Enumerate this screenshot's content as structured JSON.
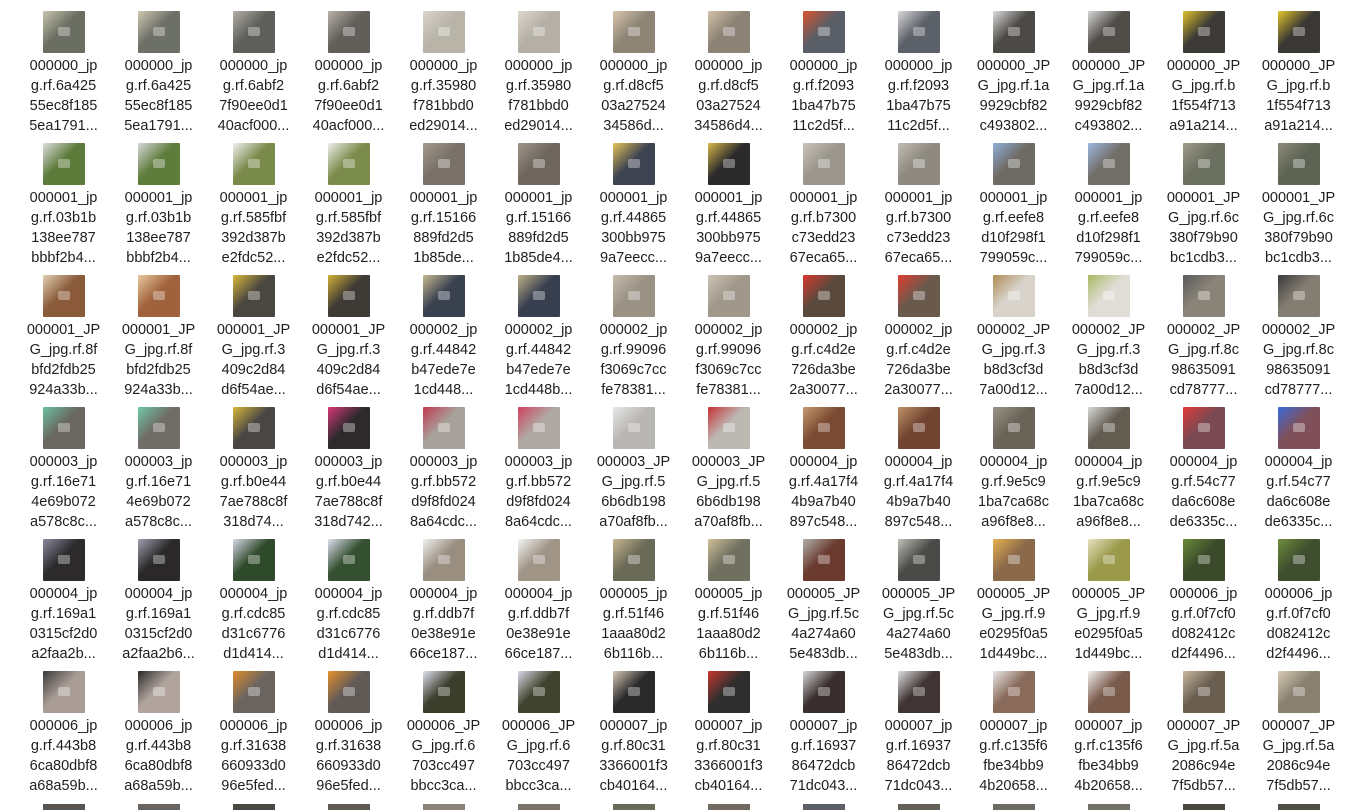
{
  "rows": [
    [
      {
        "lines": [
          "000000_jp",
          "g.rf.6a425",
          "55ec8f185",
          "5ea1791..."
        ],
        "thumb_color": "#6b6e62",
        "accent": "#c8c4b0"
      },
      {
        "lines": [
          "000000_jp",
          "g.rf.6a425",
          "55ec8f185",
          "5ea1791..."
        ],
        "thumb_color": "#6d7066",
        "accent": "#cfc8b3"
      },
      {
        "lines": [
          "000000_jp",
          "g.rf.6abf2",
          "7f90ee0d1",
          "40acf000..."
        ],
        "thumb_color": "#5e5e5a",
        "accent": "#b3b0a8"
      },
      {
        "lines": [
          "000000_jp",
          "g.rf.6abf2",
          "7f90ee0d1",
          "40acf000..."
        ],
        "thumb_color": "#625f5a",
        "accent": "#b8b3a9"
      },
      {
        "lines": [
          "000000_jp",
          "g.rf.35980",
          "f781bbd0",
          "ed29014..."
        ],
        "thumb_color": "#b9b4a8",
        "accent": "#dad5ca"
      },
      {
        "lines": [
          "000000_jp",
          "g.rf.35980",
          "f781bbd0",
          "ed29014..."
        ],
        "thumb_color": "#b5b0a5",
        "accent": "#ddd7cc"
      },
      {
        "lines": [
          "000000_jp",
          "g.rf.d8cf5",
          "03a27524",
          "34586d..."
        ],
        "thumb_color": "#8f8577",
        "accent": "#d8c6ac"
      },
      {
        "lines": [
          "000000_jp",
          "g.rf.d8cf5",
          "03a27524",
          "34586d4..."
        ],
        "thumb_color": "#8c8275",
        "accent": "#d2c1a6"
      },
      {
        "lines": [
          "000000_jp",
          "g.rf.f2093",
          "1ba47b75",
          "11c2d5f..."
        ],
        "thumb_color": "#5a5e66",
        "accent": "#d8542e"
      },
      {
        "lines": [
          "000000_jp",
          "g.rf.f2093",
          "1ba47b75",
          "11c2d5f..."
        ],
        "thumb_color": "#5c6068",
        "accent": "#d8d8d8"
      },
      {
        "lines": [
          "000000_JP",
          "G_jpg.rf.1a",
          "9929cbf82",
          "c493802..."
        ],
        "thumb_color": "#4c4a46",
        "accent": "#dcdcdc"
      },
      {
        "lines": [
          "000000_JP",
          "G_jpg.rf.1a",
          "9929cbf82",
          "c493802..."
        ],
        "thumb_color": "#504d48",
        "accent": "#d6d6d6"
      },
      {
        "lines": [
          "000000_JP",
          "G_jpg.rf.b",
          "1f554f713",
          "a91a214..."
        ],
        "thumb_color": "#3c3a36",
        "accent": "#e0c22a"
      },
      {
        "lines": [
          "000000_JP",
          "G_jpg.rf.b",
          "1f554f713",
          "a91a214..."
        ],
        "thumb_color": "#3a3834",
        "accent": "#e3c52c"
      }
    ],
    [
      {
        "lines": [
          "000001_jp",
          "g.rf.03b1b",
          "138ee787",
          "bbbf2b4..."
        ],
        "thumb_color": "#5c7a3a",
        "accent": "#dedede"
      },
      {
        "lines": [
          "000001_jp",
          "g.rf.03b1b",
          "138ee787",
          "bbbf2b4..."
        ],
        "thumb_color": "#5e7c3c",
        "accent": "#d8d8d8"
      },
      {
        "lines": [
          "000001_jp",
          "g.rf.585fbf",
          "392d387b",
          "e2fdc52..."
        ],
        "thumb_color": "#7a8a4a",
        "accent": "#f0f0f0"
      },
      {
        "lines": [
          "000001_jp",
          "g.rf.585fbf",
          "392d387b",
          "e2fdc52..."
        ],
        "thumb_color": "#7c8c4c",
        "accent": "#eeeeee"
      },
      {
        "lines": [
          "000001_jp",
          "g.rf.15166",
          "889fd2d5",
          "1b85de..."
        ],
        "thumb_color": "#7a7268",
        "accent": "#a39a8e"
      },
      {
        "lines": [
          "000001_jp",
          "g.rf.15166",
          "889fd2d5",
          "1b85de4..."
        ],
        "thumb_color": "#6f675d",
        "accent": "#9e958a"
      },
      {
        "lines": [
          "000001_jp",
          "g.rf.44865",
          "300bb975",
          "9a7eecc..."
        ],
        "thumb_color": "#3e4452",
        "accent": "#e5c35a"
      },
      {
        "lines": [
          "000001_jp",
          "g.rf.44865",
          "300bb975",
          "9a7eecc..."
        ],
        "thumb_color": "#2a2a2a",
        "accent": "#d9b84a"
      },
      {
        "lines": [
          "000001_jp",
          "g.rf.b7300",
          "c73edd23",
          "67eca65..."
        ],
        "thumb_color": "#9a968c",
        "accent": "#c8c4ba"
      },
      {
        "lines": [
          "000001_jp",
          "g.rf.b7300",
          "c73edd23",
          "67eca65..."
        ],
        "thumb_color": "#8e8a80",
        "accent": "#c0bcb2"
      },
      {
        "lines": [
          "000001_jp",
          "g.rf.eefe8",
          "d10f298f1",
          "799059c..."
        ],
        "thumb_color": "#6e6a64",
        "accent": "#8fb0d8"
      },
      {
        "lines": [
          "000001_jp",
          "g.rf.eefe8",
          "d10f298f1",
          "799059c..."
        ],
        "thumb_color": "#726e68",
        "accent": "#9ab8de"
      },
      {
        "lines": [
          "000001_JP",
          "G_jpg.rf.6c",
          "380f79b90",
          "bc1cdb3..."
        ],
        "thumb_color": "#6c7060",
        "accent": "#a09a8a"
      },
      {
        "lines": [
          "000001_JP",
          "G_jpg.rf.6c",
          "380f79b90",
          "bc1cdb3..."
        ],
        "thumb_color": "#5e6454",
        "accent": "#8e8a7a"
      }
    ],
    [
      {
        "lines": [
          "000001_JP",
          "G_jpg.rf.8f",
          "bfd2fdb25",
          "924a33b..."
        ],
        "thumb_color": "#8a5a3a",
        "accent": "#e0d0b0"
      },
      {
        "lines": [
          "000001_JP",
          "G_jpg.rf.8f",
          "bfd2fdb25",
          "924a33b..."
        ],
        "thumb_color": "#a0623c",
        "accent": "#e8c89e"
      },
      {
        "lines": [
          "000001_JP",
          "G_jpg.rf.3",
          "409c2d84",
          "d6f54ae..."
        ],
        "thumb_color": "#4a4640",
        "accent": "#d8b83a"
      },
      {
        "lines": [
          "000001_JP",
          "G_jpg.rf.3",
          "409c2d84",
          "d6f54ae..."
        ],
        "thumb_color": "#3e3a36",
        "accent": "#d2b036"
      },
      {
        "lines": [
          "000002_jp",
          "g.rf.44842",
          "b47ede7e",
          "1cd448..."
        ],
        "thumb_color": "#3a4250",
        "accent": "#c8b890"
      },
      {
        "lines": [
          "000002_jp",
          "g.rf.44842",
          "b47ede7e",
          "1cd448b..."
        ],
        "thumb_color": "#384050",
        "accent": "#c0b088"
      },
      {
        "lines": [
          "000002_jp",
          "g.rf.99096",
          "f3069c7cc",
          "fe78381..."
        ],
        "thumb_color": "#9a9284",
        "accent": "#c4bcae"
      },
      {
        "lines": [
          "000002_jp",
          "g.rf.99096",
          "f3069c7cc",
          "fe78381..."
        ],
        "thumb_color": "#a0988a",
        "accent": "#cac2b4"
      },
      {
        "lines": [
          "000002_jp",
          "g.rf.c4d2e",
          "726da3be",
          "2a30077..."
        ],
        "thumb_color": "#5a4a3e",
        "accent": "#d8382e"
      },
      {
        "lines": [
          "000002_jp",
          "g.rf.c4d2e",
          "726da3be",
          "2a30077..."
        ],
        "thumb_color": "#6a5a4c",
        "accent": "#e03c30"
      },
      {
        "lines": [
          "000002_JP",
          "G_jpg.rf.3",
          "b8d3cf3d",
          "7a00d12..."
        ],
        "thumb_color": "#d8d4cc",
        "accent": "#b08a52"
      },
      {
        "lines": [
          "000002_JP",
          "G_jpg.rf.3",
          "b8d3cf3d",
          "7a00d12..."
        ],
        "thumb_color": "#e0ddd6",
        "accent": "#a8b860"
      },
      {
        "lines": [
          "000002_JP",
          "G_jpg.rf.8c",
          "98635091",
          "cd78777..."
        ],
        "thumb_color": "#8a8478",
        "accent": "#5a5a5a"
      },
      {
        "lines": [
          "000002_JP",
          "G_jpg.rf.8c",
          "98635091",
          "cd78777..."
        ],
        "thumb_color": "#847e72",
        "accent": "#3a3a3a"
      }
    ],
    [
      {
        "lines": [
          "000003_jp",
          "g.rf.16e71",
          "4e69b072",
          "a578c8c..."
        ],
        "thumb_color": "#6a6660",
        "accent": "#6ac0a0"
      },
      {
        "lines": [
          "000003_jp",
          "g.rf.16e71",
          "4e69b072",
          "a578c8c..."
        ],
        "thumb_color": "#706c66",
        "accent": "#70c8a8"
      },
      {
        "lines": [
          "000003_jp",
          "g.rf.b0e44",
          "7ae788c8f",
          "318d74..."
        ],
        "thumb_color": "#4a4644",
        "accent": "#d8b83a"
      },
      {
        "lines": [
          "000003_jp",
          "g.rf.b0e44",
          "7ae788c8f",
          "318d742..."
        ],
        "thumb_color": "#2e2a2c",
        "accent": "#d8387a"
      },
      {
        "lines": [
          "000003_jp",
          "g.rf.bb572",
          "d9f8fd024",
          "8a64cdc..."
        ],
        "thumb_color": "#a8a09a",
        "accent": "#c03850"
      },
      {
        "lines": [
          "000003_jp",
          "g.rf.bb572",
          "d9f8fd024",
          "8a64cdc..."
        ],
        "thumb_color": "#b0a8a2",
        "accent": "#d04060"
      },
      {
        "lines": [
          "000003_JP",
          "G_jpg.rf.5",
          "6b6db198",
          "a70af8fb..."
        ],
        "thumb_color": "#b8b6b2",
        "accent": "#e8e8e8"
      },
      {
        "lines": [
          "000003_JP",
          "G_jpg.rf.5",
          "6b6db198",
          "a70af8fb..."
        ],
        "thumb_color": "#bcb8b2",
        "accent": "#c83038"
      },
      {
        "lines": [
          "000004_jp",
          "g.rf.4a17f4",
          "4b9a7b40",
          "897c548..."
        ],
        "thumb_color": "#7a4a32",
        "accent": "#c89a70"
      },
      {
        "lines": [
          "000004_jp",
          "g.rf.4a17f4",
          "4b9a7b40",
          "897c548..."
        ],
        "thumb_color": "#704430",
        "accent": "#c0926a"
      },
      {
        "lines": [
          "000004_jp",
          "g.rf.9e5c9",
          "1ba7ca68c",
          "a96f8e8..."
        ],
        "thumb_color": "#6a6458",
        "accent": "#9a9488"
      },
      {
        "lines": [
          "000004_jp",
          "g.rf.9e5c9",
          "1ba7ca68c",
          "a96f8e8..."
        ],
        "thumb_color": "#645e52",
        "accent": "#d8d8d8"
      },
      {
        "lines": [
          "000004_jp",
          "g.rf.54c77",
          "da6c608e",
          "de6335c..."
        ],
        "thumb_color": "#7a4a52",
        "accent": "#e03a3a"
      },
      {
        "lines": [
          "000004_jp",
          "g.rf.54c77",
          "da6c608e",
          "de6335c..."
        ],
        "thumb_color": "#80505a",
        "accent": "#3a6ad8"
      }
    ],
    [
      {
        "lines": [
          "000004_jp",
          "g.rf.169a1",
          "0315cf2d0",
          "a2faa2b..."
        ],
        "thumb_color": "#2c2a2a",
        "accent": "#8a8aa0"
      },
      {
        "lines": [
          "000004_jp",
          "g.rf.169a1",
          "0315cf2d0",
          "a2faa2b6..."
        ],
        "thumb_color": "#2a2828",
        "accent": "#a0a0b0"
      },
      {
        "lines": [
          "000004_jp",
          "g.rf.cdc85",
          "d31c6776",
          "d1d414..."
        ],
        "thumb_color": "#2e4a2a",
        "accent": "#d8d8e8"
      },
      {
        "lines": [
          "000004_jp",
          "g.rf.cdc85",
          "d31c6776",
          "d1d414..."
        ],
        "thumb_color": "#345030",
        "accent": "#e0e0f0"
      },
      {
        "lines": [
          "000004_jp",
          "g.rf.ddb7f",
          "0e38e91e",
          "66ce187..."
        ],
        "thumb_color": "#9a8e80",
        "accent": "#f0f0f0"
      },
      {
        "lines": [
          "000004_jp",
          "g.rf.ddb7f",
          "0e38e91e",
          "66ce187..."
        ],
        "thumb_color": "#a09486",
        "accent": "#f4f4f4"
      },
      {
        "lines": [
          "000005_jp",
          "g.rf.51f46",
          "1aaa80d2",
          "6b116b..."
        ],
        "thumb_color": "#6a6a58",
        "accent": "#c8b890"
      },
      {
        "lines": [
          "000005_jp",
          "g.rf.51f46",
          "1aaa80d2",
          "6b116b..."
        ],
        "thumb_color": "#707060",
        "accent": "#d0c098"
      },
      {
        "lines": [
          "000005_JP",
          "G_jpg.rf.5c",
          "4a274a60",
          "5e483db..."
        ],
        "thumb_color": "#6a3a2e",
        "accent": "#b0b0a8"
      },
      {
        "lines": [
          "000005_JP",
          "G_jpg.rf.5c",
          "4a274a60",
          "5e483db..."
        ],
        "thumb_color": "#4a4a48",
        "accent": "#c0c0b8"
      },
      {
        "lines": [
          "000005_JP",
          "G_jpg.rf.9",
          "e0295f0a5",
          "1d449bc..."
        ],
        "thumb_color": "#8a6a4a",
        "accent": "#e8b050"
      },
      {
        "lines": [
          "000005_JP",
          "G_jpg.rf.9",
          "e0295f0a5",
          "1d449bc..."
        ],
        "thumb_color": "#9a9a4a",
        "accent": "#e8e0c0"
      },
      {
        "lines": [
          "000006_jp",
          "g.rf.0f7cf0",
          "d082412c",
          "d2f4496..."
        ],
        "thumb_color": "#3a4a2a",
        "accent": "#6a8a3a"
      },
      {
        "lines": [
          "000006_jp",
          "g.rf.0f7cf0",
          "d082412c",
          "d2f4496..."
        ],
        "thumb_color": "#3e4e2e",
        "accent": "#708e3e"
      }
    ],
    [
      {
        "lines": [
          "000006_jp",
          "g.rf.443b8",
          "6ca80dbf8",
          "a68a59b..."
        ],
        "thumb_color": "#a89c94",
        "accent": "#3a3a3a"
      },
      {
        "lines": [
          "000006_jp",
          "g.rf.443b8",
          "6ca80dbf8",
          "a68a59b..."
        ],
        "thumb_color": "#b0a49c",
        "accent": "#2a2a2a"
      },
      {
        "lines": [
          "000006_jp",
          "g.rf.31638",
          "660933d0",
          "96e5fed..."
        ],
        "thumb_color": "#6a6460",
        "accent": "#e08a2a"
      },
      {
        "lines": [
          "000006_jp",
          "g.rf.31638",
          "660933d0",
          "96e5fed..."
        ],
        "thumb_color": "#605a56",
        "accent": "#e8902e"
      },
      {
        "lines": [
          "000006_JP",
          "G_jpg.rf.6",
          "703cc497",
          "bbcc3ca..."
        ],
        "thumb_color": "#3a3e2a",
        "accent": "#e0e0f0"
      },
      {
        "lines": [
          "000006_JP",
          "G_jpg.rf.6",
          "703cc497",
          "bbcc3ca..."
        ],
        "thumb_color": "#40442e",
        "accent": "#d8d8e8"
      },
      {
        "lines": [
          "000007_jp",
          "g.rf.80c31",
          "3366001f3",
          "cb40164..."
        ],
        "thumb_color": "#2a2a2a",
        "accent": "#d8c8b8"
      },
      {
        "lines": [
          "000007_jp",
          "g.rf.80c31",
          "3366001f3",
          "cb40164..."
        ],
        "thumb_color": "#2e2e2e",
        "accent": "#c8382e"
      },
      {
        "lines": [
          "000007_jp",
          "g.rf.16937",
          "86472dcb",
          "71dc043..."
        ],
        "thumb_color": "#3a2e2e",
        "accent": "#d8d8d8"
      },
      {
        "lines": [
          "000007_jp",
          "g.rf.16937",
          "86472dcb",
          "71dc043..."
        ],
        "thumb_color": "#403434",
        "accent": "#e0e0e0"
      },
      {
        "lines": [
          "000007_jp",
          "g.rf.c135f6",
          "fbe34bb9",
          "4b20658..."
        ],
        "thumb_color": "#8a6a5a",
        "accent": "#e8e8e8"
      },
      {
        "lines": [
          "000007_jp",
          "g.rf.c135f6",
          "fbe34bb9",
          "4b20658..."
        ],
        "thumb_color": "#7a5a4a",
        "accent": "#f0f0f0"
      },
      {
        "lines": [
          "000007_JP",
          "G_jpg.rf.5a",
          "2086c94e",
          "7f5db57..."
        ],
        "thumb_color": "#6a5e50",
        "accent": "#c8b8a0"
      },
      {
        "lines": [
          "000007_JP",
          "G_jpg.rf.5a",
          "2086c94e",
          "7f5db57..."
        ],
        "thumb_color": "#8a8070",
        "accent": "#d8ccb8"
      }
    ]
  ],
  "partial_row_colors": [
    "#5a5450",
    "#6a6460",
    "#4a4a44",
    "#5e5a52",
    "#8a8478",
    "#7a7468",
    "#6a6a58",
    "#706a60",
    "#5a5e66",
    "#646058",
    "#6e6a64",
    "#726e68",
    "#4a4640",
    "#504c46"
  ]
}
